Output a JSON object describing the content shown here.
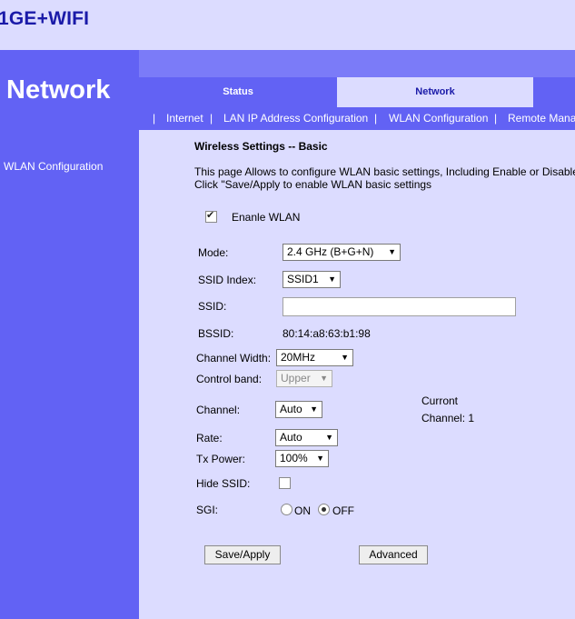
{
  "brand": "1GE+WIFI",
  "sidebar": {
    "title": "Network",
    "items": [
      {
        "label": "WLAN Configuration"
      }
    ]
  },
  "tabs": [
    {
      "label": "Status"
    },
    {
      "label": "Network"
    }
  ],
  "subnav": [
    "Internet",
    "LAN IP Address Configuration",
    "WLAN Configuration",
    "Remote Mana"
  ],
  "form": {
    "heading": "Wireless Settings -- Basic",
    "desc_line1": "This page Allows to configure WLAN basic settings, Including Enable or Disable",
    "desc_line2": "Click \"Save/Apply to enable WLAN basic settings",
    "enable_wlan_label": "Enanle WLAN",
    "mode_label": "Mode:",
    "mode_value": "2.4 GHz (B+G+N)",
    "ssid_index_label": "SSID Index:",
    "ssid_index_value": "SSID1",
    "ssid_label": "SSID:",
    "ssid_value": "",
    "bssid_label": "BSSID:",
    "bssid_value": "80:14:a8:63:b1:98",
    "channel_width_label": "Channel Width:",
    "channel_width_value": "20MHz",
    "control_band_label": "Control band:",
    "control_band_value": "Upper",
    "channel_label": "Channel:",
    "channel_value": "Auto",
    "current_label": "Curront",
    "current_channel": "Channel: 1",
    "rate_label": "Rate:",
    "rate_value": "Auto",
    "tx_power_label": "Tx Power:",
    "tx_power_value": "100%",
    "hide_ssid_label": "Hide SSID:",
    "sgi_label": "SGI:",
    "sgi_on": "ON",
    "sgi_off": "OFF",
    "save_label": "Save/Apply",
    "advanced_label": "Advanced"
  }
}
